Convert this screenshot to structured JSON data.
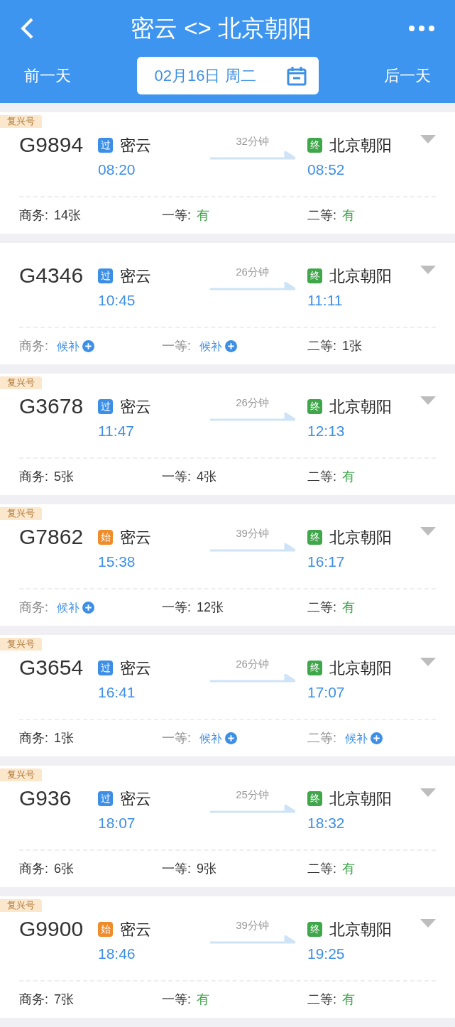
{
  "header": {
    "title": "密云 <> 北京朝阳",
    "prev_day": "前一天",
    "date": "02月16日 周二",
    "next_day": "后一天"
  },
  "trains": [
    {
      "badge": "复兴号",
      "number": "G9894",
      "from_tag": {
        "kind": "pass",
        "text": "过"
      },
      "from": "密云",
      "depart": "08:20",
      "duration": "32分钟",
      "to_tag": {
        "kind": "end",
        "text": "终"
      },
      "to": "北京朝阳",
      "arrive": "08:52",
      "seats": [
        {
          "label": "商务:",
          "kind": "count",
          "value": "14张"
        },
        {
          "label": "一等:",
          "kind": "available",
          "value": "有"
        },
        {
          "label": "二等:",
          "kind": "available",
          "value": "有"
        }
      ]
    },
    {
      "number": "G4346",
      "from_tag": {
        "kind": "pass",
        "text": "过"
      },
      "from": "密云",
      "depart": "10:45",
      "duration": "26分钟",
      "to_tag": {
        "kind": "end",
        "text": "终"
      },
      "to": "北京朝阳",
      "arrive": "11:11",
      "seats": [
        {
          "label": "商务:",
          "kind": "waitlist",
          "value": "候补"
        },
        {
          "label": "一等:",
          "kind": "waitlist",
          "value": "候补"
        },
        {
          "label": "二等:",
          "kind": "count",
          "value": "1张"
        }
      ]
    },
    {
      "badge": "复兴号",
      "number": "G3678",
      "from_tag": {
        "kind": "pass",
        "text": "过"
      },
      "from": "密云",
      "depart": "11:47",
      "duration": "26分钟",
      "to_tag": {
        "kind": "end",
        "text": "终"
      },
      "to": "北京朝阳",
      "arrive": "12:13",
      "seats": [
        {
          "label": "商务:",
          "kind": "count",
          "value": "5张"
        },
        {
          "label": "一等:",
          "kind": "count",
          "value": "4张"
        },
        {
          "label": "二等:",
          "kind": "available",
          "value": "有"
        }
      ]
    },
    {
      "badge": "复兴号",
      "number": "G7862",
      "from_tag": {
        "kind": "start",
        "text": "始"
      },
      "from": "密云",
      "depart": "15:38",
      "duration": "39分钟",
      "to_tag": {
        "kind": "end",
        "text": "终"
      },
      "to": "北京朝阳",
      "arrive": "16:17",
      "seats": [
        {
          "label": "商务:",
          "kind": "waitlist",
          "value": "候补"
        },
        {
          "label": "一等:",
          "kind": "count",
          "value": "12张"
        },
        {
          "label": "二等:",
          "kind": "available",
          "value": "有"
        }
      ]
    },
    {
      "badge": "复兴号",
      "number": "G3654",
      "from_tag": {
        "kind": "pass",
        "text": "过"
      },
      "from": "密云",
      "depart": "16:41",
      "duration": "26分钟",
      "to_tag": {
        "kind": "end",
        "text": "终"
      },
      "to": "北京朝阳",
      "arrive": "17:07",
      "seats": [
        {
          "label": "商务:",
          "kind": "count",
          "value": "1张"
        },
        {
          "label": "一等:",
          "kind": "waitlist",
          "value": "候补"
        },
        {
          "label": "二等:",
          "kind": "waitlist",
          "value": "候补"
        }
      ]
    },
    {
      "badge": "复兴号",
      "number": "G936",
      "from_tag": {
        "kind": "pass",
        "text": "过"
      },
      "from": "密云",
      "depart": "18:07",
      "duration": "25分钟",
      "to_tag": {
        "kind": "end",
        "text": "终"
      },
      "to": "北京朝阳",
      "arrive": "18:32",
      "seats": [
        {
          "label": "商务:",
          "kind": "count",
          "value": "6张"
        },
        {
          "label": "一等:",
          "kind": "count",
          "value": "9张"
        },
        {
          "label": "二等:",
          "kind": "available",
          "value": "有"
        }
      ]
    },
    {
      "badge": "复兴号",
      "number": "G9900",
      "from_tag": {
        "kind": "start",
        "text": "始"
      },
      "from": "密云",
      "depart": "18:46",
      "duration": "39分钟",
      "to_tag": {
        "kind": "end",
        "text": "终"
      },
      "to": "北京朝阳",
      "arrive": "19:25",
      "seats": [
        {
          "label": "商务:",
          "kind": "count",
          "value": "7张"
        },
        {
          "label": "一等:",
          "kind": "available",
          "value": "有"
        },
        {
          "label": "二等:",
          "kind": "available",
          "value": "有"
        }
      ]
    }
  ]
}
